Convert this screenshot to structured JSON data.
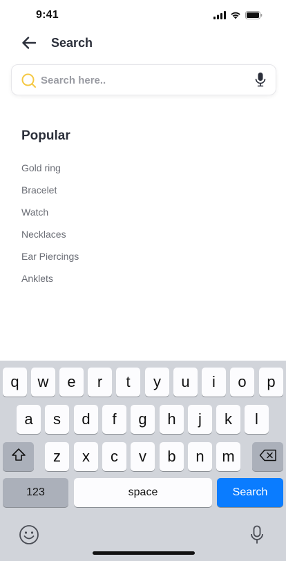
{
  "status_bar": {
    "time": "9:41",
    "icons": [
      "signal-icon",
      "wifi-icon",
      "battery-icon"
    ]
  },
  "header": {
    "title": "Search",
    "back_icon": "arrow-left-icon"
  },
  "search": {
    "placeholder": "Search here..",
    "value": "",
    "icon": "search-icon",
    "mic_icon": "microphone-icon"
  },
  "popular": {
    "title": "Popular",
    "items": [
      "Gold ring",
      "Bracelet",
      "Watch",
      "Necklaces",
      "Ear Piercings",
      "Anklets"
    ]
  },
  "keyboard": {
    "row1": [
      "q",
      "w",
      "e",
      "r",
      "t",
      "y",
      "u",
      "i",
      "o",
      "p"
    ],
    "row2": [
      "a",
      "s",
      "d",
      "f",
      "g",
      "h",
      "j",
      "k",
      "l"
    ],
    "row3": [
      "z",
      "x",
      "c",
      "v",
      "b",
      "n",
      "m"
    ],
    "numbers_label": "123",
    "space_label": "space",
    "search_label": "Search",
    "icons": [
      "shift-icon",
      "backspace-icon",
      "emoji-icon",
      "dictation-icon"
    ]
  },
  "colors": {
    "accent": "#0a7cff",
    "search_icon": "#f5c842",
    "text": "#2b2f3a",
    "muted": "#6a6d75",
    "keyboard_bg": "#d1d4da"
  }
}
